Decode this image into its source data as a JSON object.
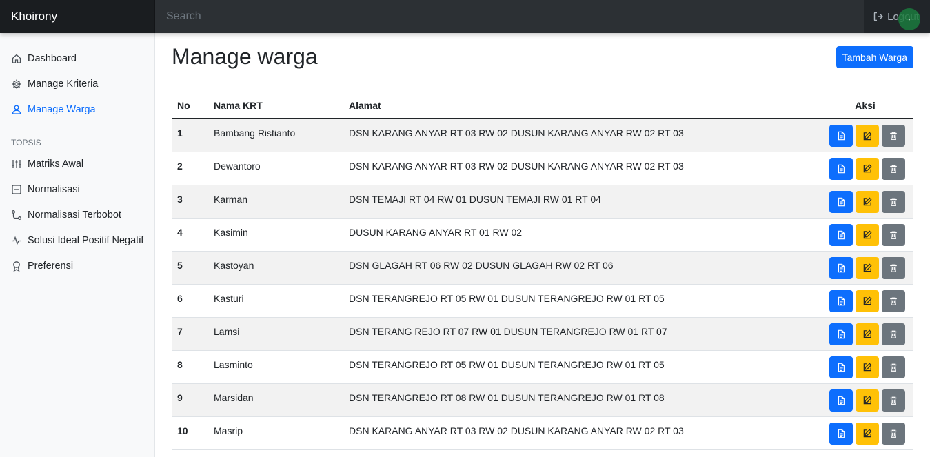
{
  "brand": "Khoirony",
  "search": {
    "placeholder": "Search"
  },
  "logout_label": "Logout",
  "sidebar": {
    "items": [
      {
        "label": "Dashboard",
        "icon": "home-icon"
      },
      {
        "label": "Manage Kriteria",
        "icon": "gear-icon"
      },
      {
        "label": "Manage Warga",
        "icon": "user-icon",
        "active": true
      }
    ],
    "section_heading": "TOPSIS",
    "topsis_items": [
      {
        "label": "Matriks Awal",
        "icon": "sliders-icon"
      },
      {
        "label": "Normalisasi",
        "icon": "calculator-icon"
      },
      {
        "label": "Normalisasi Terbobot",
        "icon": "bezier-icon"
      },
      {
        "label": "Solusi Ideal Positif Negatif",
        "icon": "activity-icon"
      },
      {
        "label": "Preferensi",
        "icon": "award-icon"
      }
    ]
  },
  "main": {
    "title": "Manage warga",
    "add_button": "Tambah Warga",
    "table": {
      "headers": [
        "No",
        "Nama KRT",
        "Alamat",
        "Aksi"
      ],
      "rows": [
        {
          "no": "1",
          "name": "Bambang Ristianto",
          "address": "DSN KARANG ANYAR RT 03 RW 02 DUSUN KARANG ANYAR RW 02 RT 03"
        },
        {
          "no": "2",
          "name": "Dewantoro",
          "address": "DSN KARANG ANYAR RT 03 RW 02 DUSUN KARANG ANYAR RW 02 RT 03"
        },
        {
          "no": "3",
          "name": "Karman",
          "address": "DSN TEMAJI RT 04 RW 01 DUSUN TEMAJI RW 01 RT 04"
        },
        {
          "no": "4",
          "name": "Kasimin",
          "address": "DUSUN KARANG ANYAR RT 01 RW 02"
        },
        {
          "no": "5",
          "name": "Kastoyan",
          "address": "DSN GLAGAH RT 06 RW 02 DUSUN GLAGAH RW 02 RT 06"
        },
        {
          "no": "6",
          "name": "Kasturi",
          "address": "DSN TERANGREJO RT 05 RW 01 DUSUN TERANGREJO RW 01 RT 05"
        },
        {
          "no": "7",
          "name": "Lamsi",
          "address": "DSN TERANG REJO RT 07 RW 01 DUSUN TERANGREJO RW 01 RT 07"
        },
        {
          "no": "8",
          "name": "Lasminto",
          "address": "DSN TERANGREJO RT 05 RW 01 DUSUN TERANGREJO RW 01 RT 05"
        },
        {
          "no": "9",
          "name": "Marsidan",
          "address": "DSN TERANGREJO RT 08 RW 01 DUSUN TERANGREJO RW 01 RT 08"
        },
        {
          "no": "10",
          "name": "Masrip",
          "address": "DSN KARANG ANYAR RT 03 RW 02 DUSUN KARANG ANYAR RW 02 RT 03"
        }
      ]
    }
  },
  "colors": {
    "primary": "#0d6efd",
    "warning": "#ffc107",
    "secondary": "#6c757d",
    "navbar": "#212529"
  }
}
